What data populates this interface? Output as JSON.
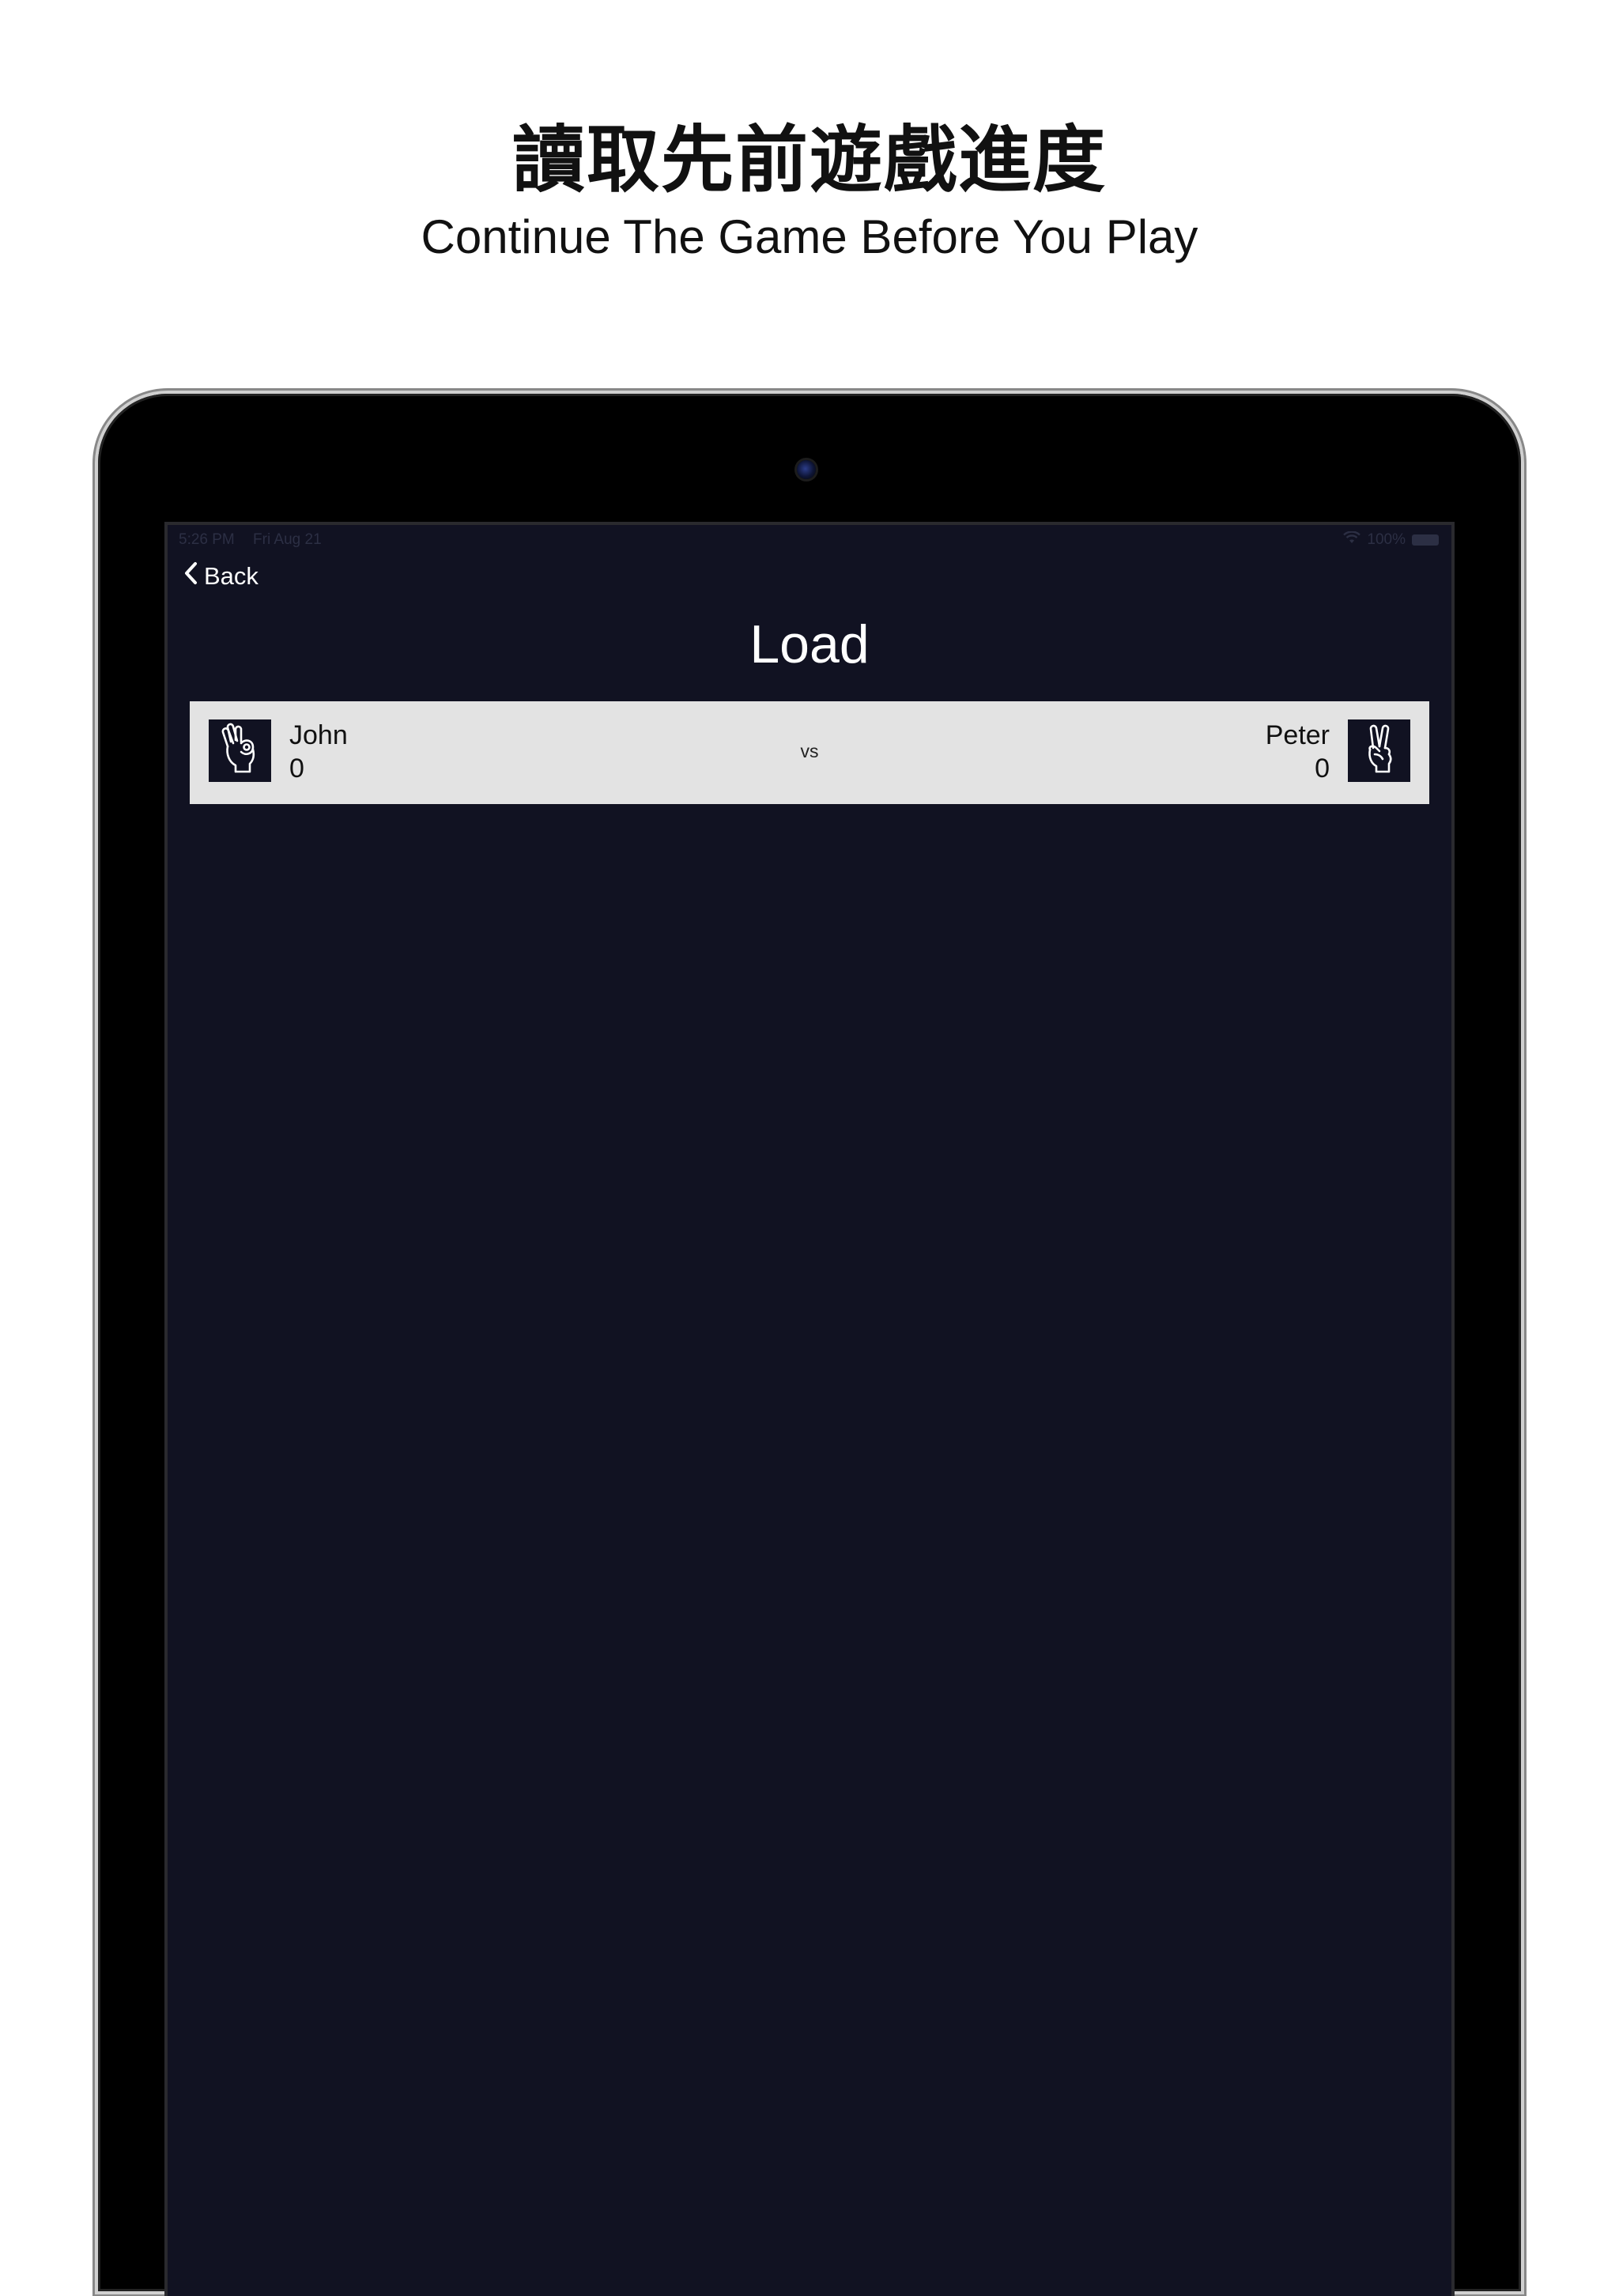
{
  "promo": {
    "title": "讀取先前遊戲進度",
    "subtitle": "Continue The Game Before You Play"
  },
  "status_bar": {
    "time": "5:26 PM",
    "date": "Fri Aug 21",
    "battery": "100%",
    "wifi_icon": "wifi-icon",
    "battery_icon": "battery-icon"
  },
  "nav": {
    "back_label": "Back",
    "back_icon": "chevron-left-icon"
  },
  "screen": {
    "title": "Load"
  },
  "games": [
    {
      "player1": {
        "name": "John",
        "score": "0",
        "gesture_icon": "ok-hand-icon"
      },
      "vs_label": "vs",
      "player2": {
        "name": "Peter",
        "score": "0",
        "gesture_icon": "victory-hand-icon"
      }
    }
  ],
  "colors": {
    "screen_background": "#111222",
    "row_background": "#e3e3e3",
    "text_light": "#ffffff",
    "text_dark": "#111111"
  }
}
